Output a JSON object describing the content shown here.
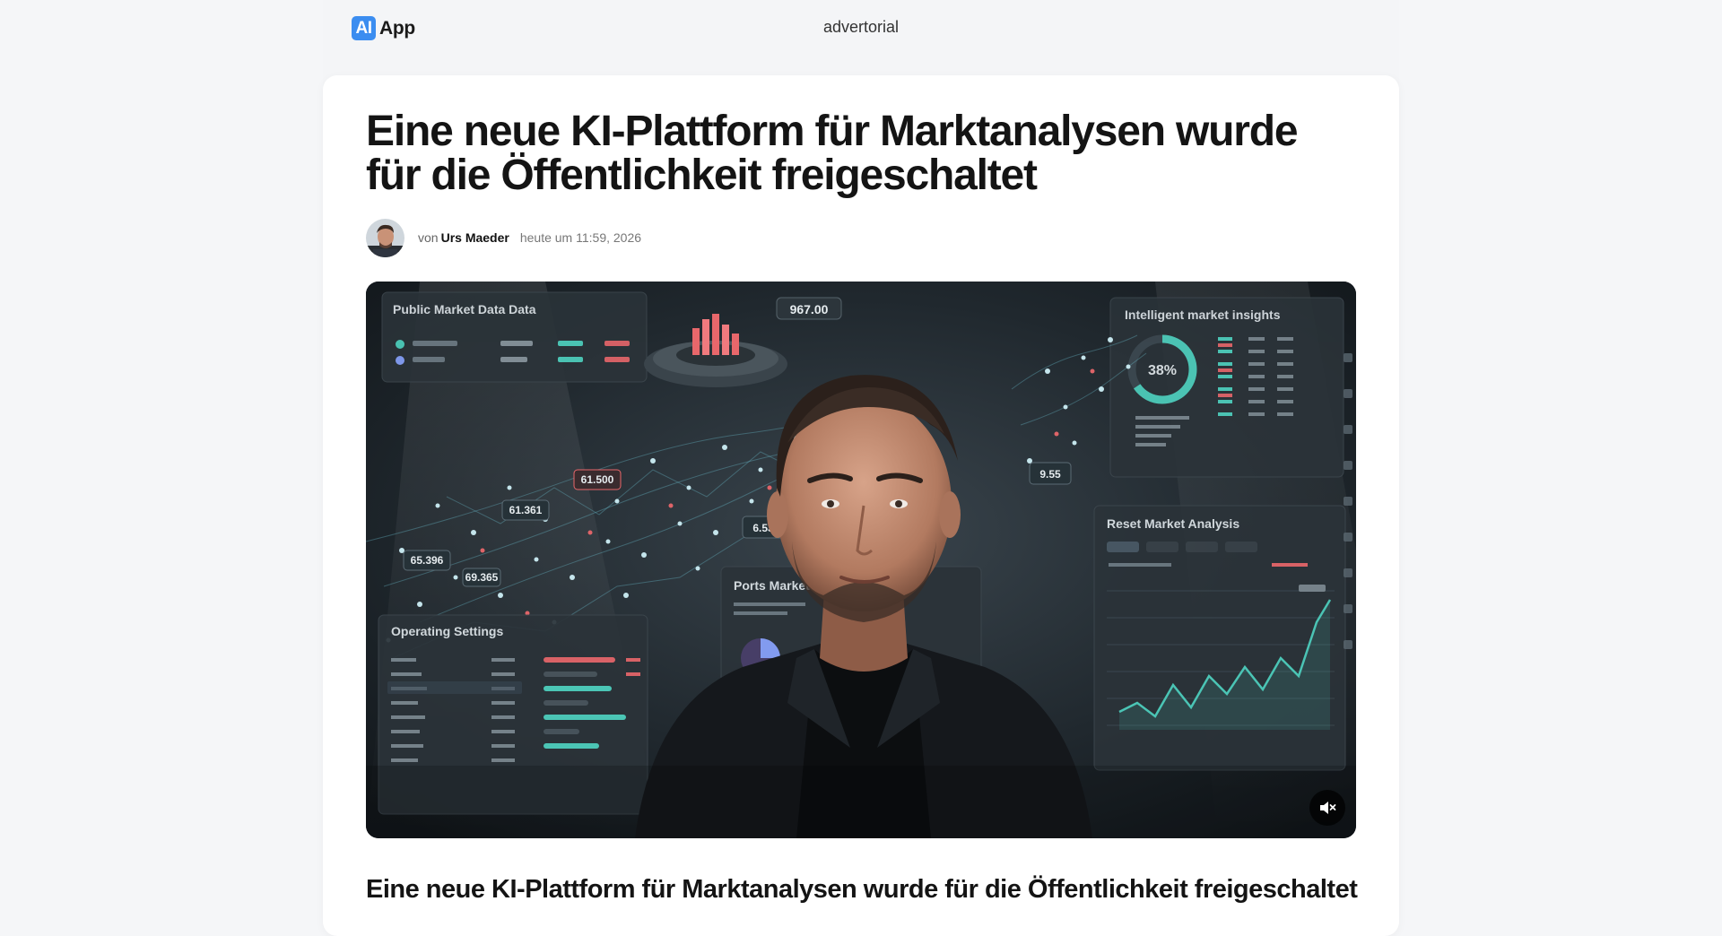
{
  "header": {
    "logo_badge": "AI",
    "logo_text": "App",
    "tagline": "advertorial"
  },
  "article": {
    "headline": "Eine neue KI-Plattform für Marktanalysen wurde für die Öffentlichkeit freigeschaltet",
    "byline_prefix": "von",
    "author": "Urs Maeder",
    "date": "heute um 11:59, 2026",
    "subheadline": "Eine neue KI-Plattform für Marktanalysen wurde für die Öffentlichkeit freigeschaltet"
  },
  "video": {
    "muted": true,
    "mute_icon": "speaker-muted-icon",
    "screen_texts": {
      "panel_top_left_title": "Public Market Data Data",
      "panel_top_center_value": "967.00",
      "panel_top_right_title": "Intelligent market insights",
      "donut_percent": "38%",
      "tag_1": "61.500",
      "tag_2": "61.361",
      "tag_3": "65.396",
      "tag_4": "69.365",
      "tag_5": "6.53",
      "tag_6": "9.55",
      "panel_bottom_left_title": "Operating Settings",
      "panel_bottom_center_title": "Ports Market",
      "panel_bottom_right_title": "Reset Market Analysis"
    }
  },
  "colors": {
    "accent": "#3b8df0",
    "page_bg": "#f5f6f8",
    "card_bg": "#ffffff",
    "chart_teal": "#4fd3c1",
    "chart_red": "#e8676b"
  }
}
